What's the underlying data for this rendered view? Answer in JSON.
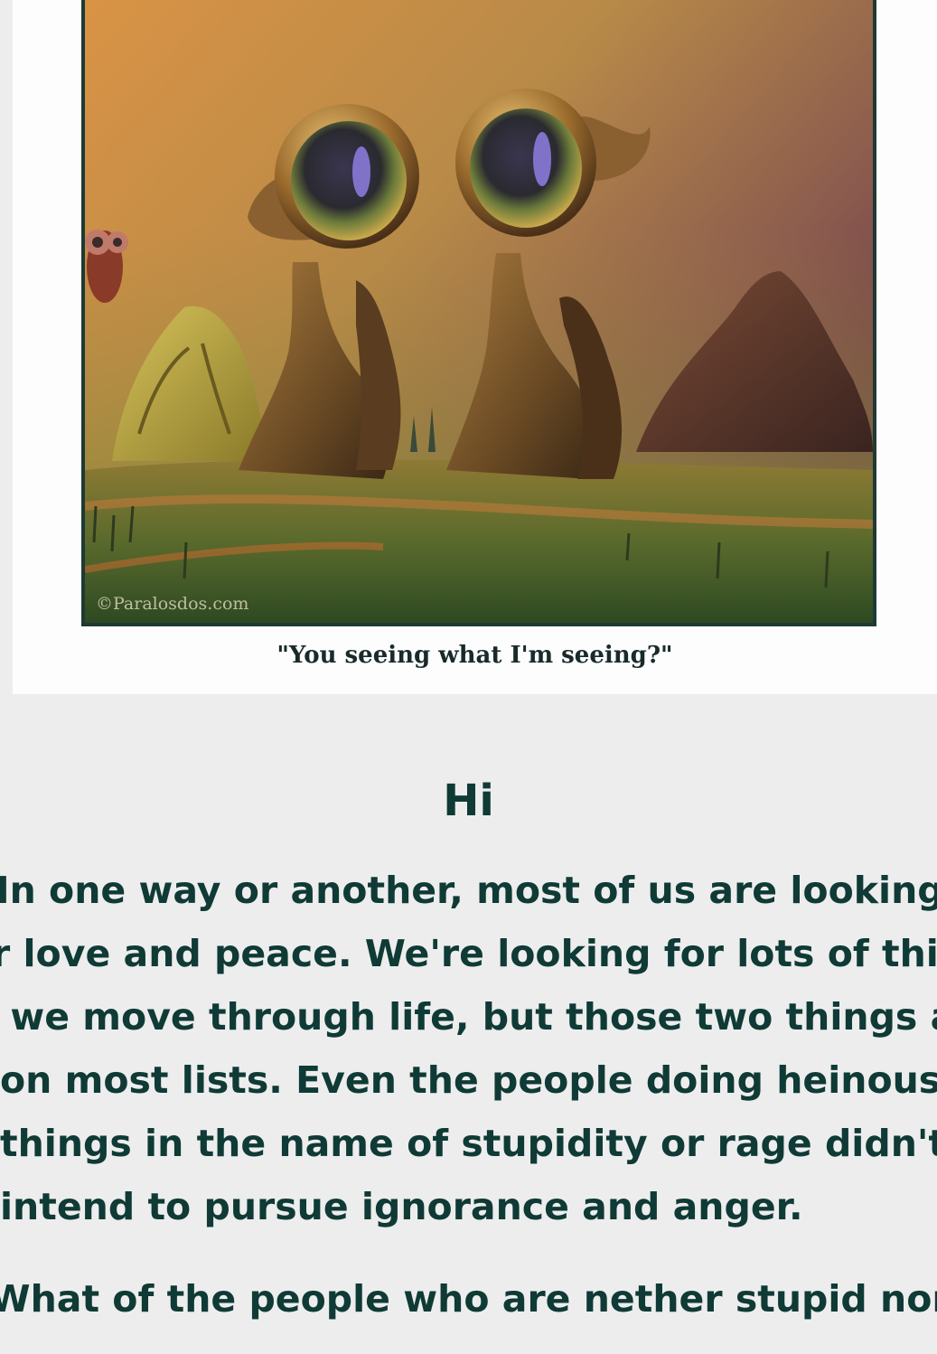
{
  "figure": {
    "watermark": "©Paralosdos.com",
    "caption": "\"You seeing what I'm seeing?\""
  },
  "article": {
    "heading": "Hi",
    "paragraph1_lines": [
      "In one way or another, most of us are looking",
      "for love and peace. We're looking for lots of things",
      "as we move through life, but those two things are",
      "on most lists. Even the people doing heinous",
      "things in the name of stupidity or rage didn't",
      "intend to pursue ignorance and anger."
    ],
    "paragraph2_start": "What of the people who are nether stupid nor"
  },
  "colors": {
    "page_background": "#ededed",
    "card_background": "#fdfdfd",
    "text": "#0f3a35",
    "image_frame": "#1f3a35"
  }
}
